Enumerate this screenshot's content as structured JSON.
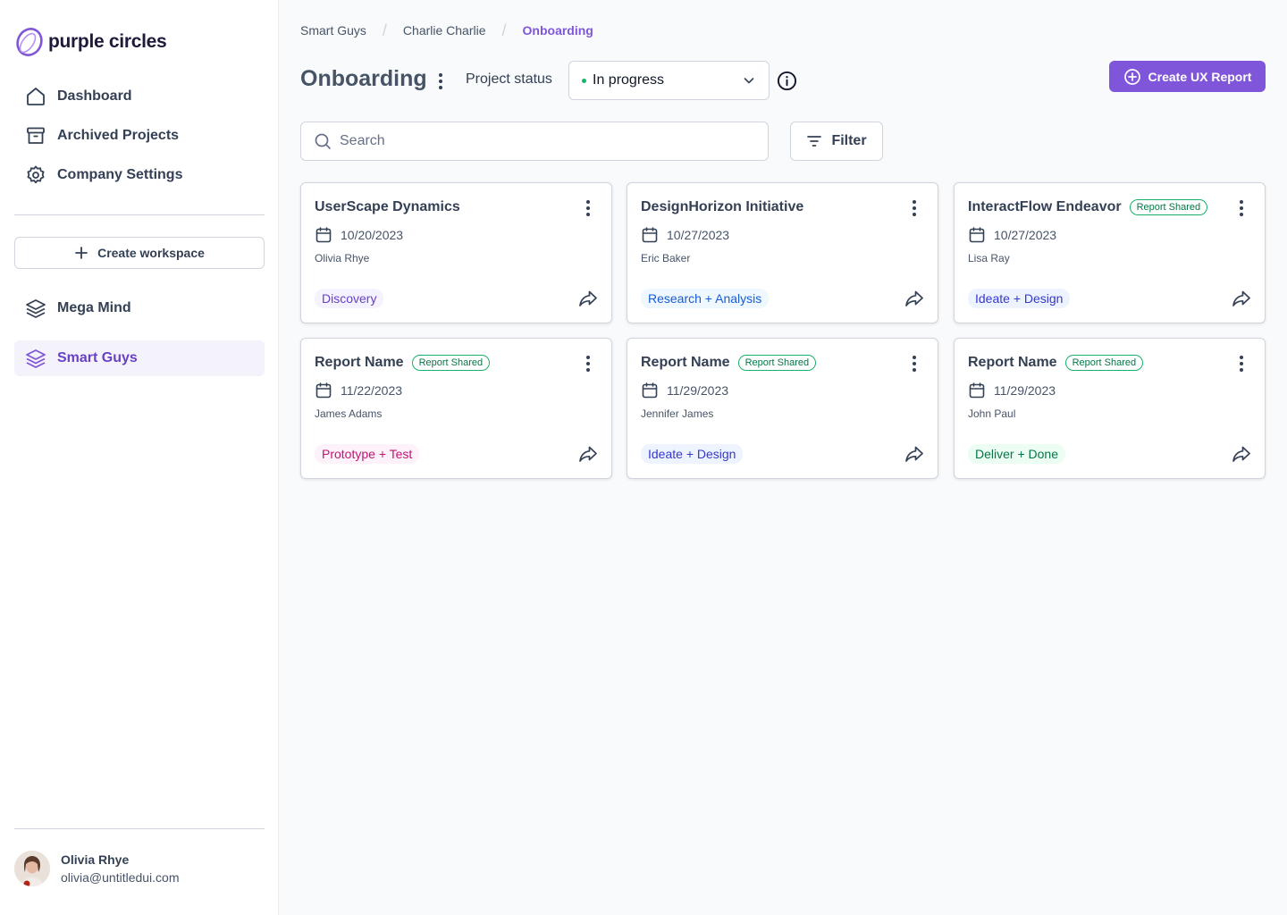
{
  "brand": {
    "name": "purple circles",
    "accent": "#7f56d9"
  },
  "sidebar": {
    "nav": [
      {
        "label": "Dashboard",
        "icon": "home-icon"
      },
      {
        "label": "Archived Projects",
        "icon": "archive-icon"
      },
      {
        "label": "Company Settings",
        "icon": "gear-icon"
      }
    ],
    "create_workspace_label": "Create workspace",
    "workspaces": [
      {
        "label": "Mega Mind",
        "icon": "layers-icon",
        "active": false
      },
      {
        "label": "Smart Guys",
        "icon": "layers-icon",
        "active": true
      }
    ],
    "user": {
      "name": "Olivia Rhye",
      "email": "olivia@untitledui.com"
    }
  },
  "breadcrumb": [
    "Smart Guys",
    "Charlie Charlie",
    "Onboarding"
  ],
  "header": {
    "title": "Onboarding",
    "status_label": "Project status",
    "status_value": "In progress",
    "create_report_label": "Create UX Report"
  },
  "search": {
    "placeholder": "Search",
    "value": ""
  },
  "filter_label": "Filter",
  "cards": [
    {
      "title": "UserScape Dynamics",
      "shared": false,
      "date": "10/20/2023",
      "person": "Olivia Rhye",
      "phase": "Discovery",
      "phase_color": "#6941c6",
      "phase_bg": "#f4f3ff"
    },
    {
      "title": "DesignHorizon Initiative",
      "shared": false,
      "date": "10/27/2023",
      "person": "Eric Baker",
      "phase": "Research + Analysis",
      "phase_color": "#175cd3",
      "phase_bg": "#eff8ff"
    },
    {
      "title": "InteractFlow Endeavor",
      "shared": true,
      "date": "10/27/2023",
      "person": "Lisa Ray",
      "phase": "Ideate + Design",
      "phase_color": "#3538cd",
      "phase_bg": "#eef4ff"
    },
    {
      "title": "Report Name",
      "shared": true,
      "date": "11/22/2023",
      "person": "James Adams",
      "phase": "Prototype + Test",
      "phase_color": "#c11574",
      "phase_bg": "#fdf2fa"
    },
    {
      "title": "Report Name",
      "shared": true,
      "date": "11/29/2023",
      "person": "Jennifer James",
      "phase": "Ideate + Design",
      "phase_color": "#3538cd",
      "phase_bg": "#eef4ff"
    },
    {
      "title": "Report Name",
      "shared": true,
      "date": "11/29/2023",
      "person": "John Paul",
      "phase": "Deliver + Done",
      "phase_color": "#067647",
      "phase_bg": "#ecfdf3"
    }
  ],
  "shared_badge_label": "Report Shared"
}
